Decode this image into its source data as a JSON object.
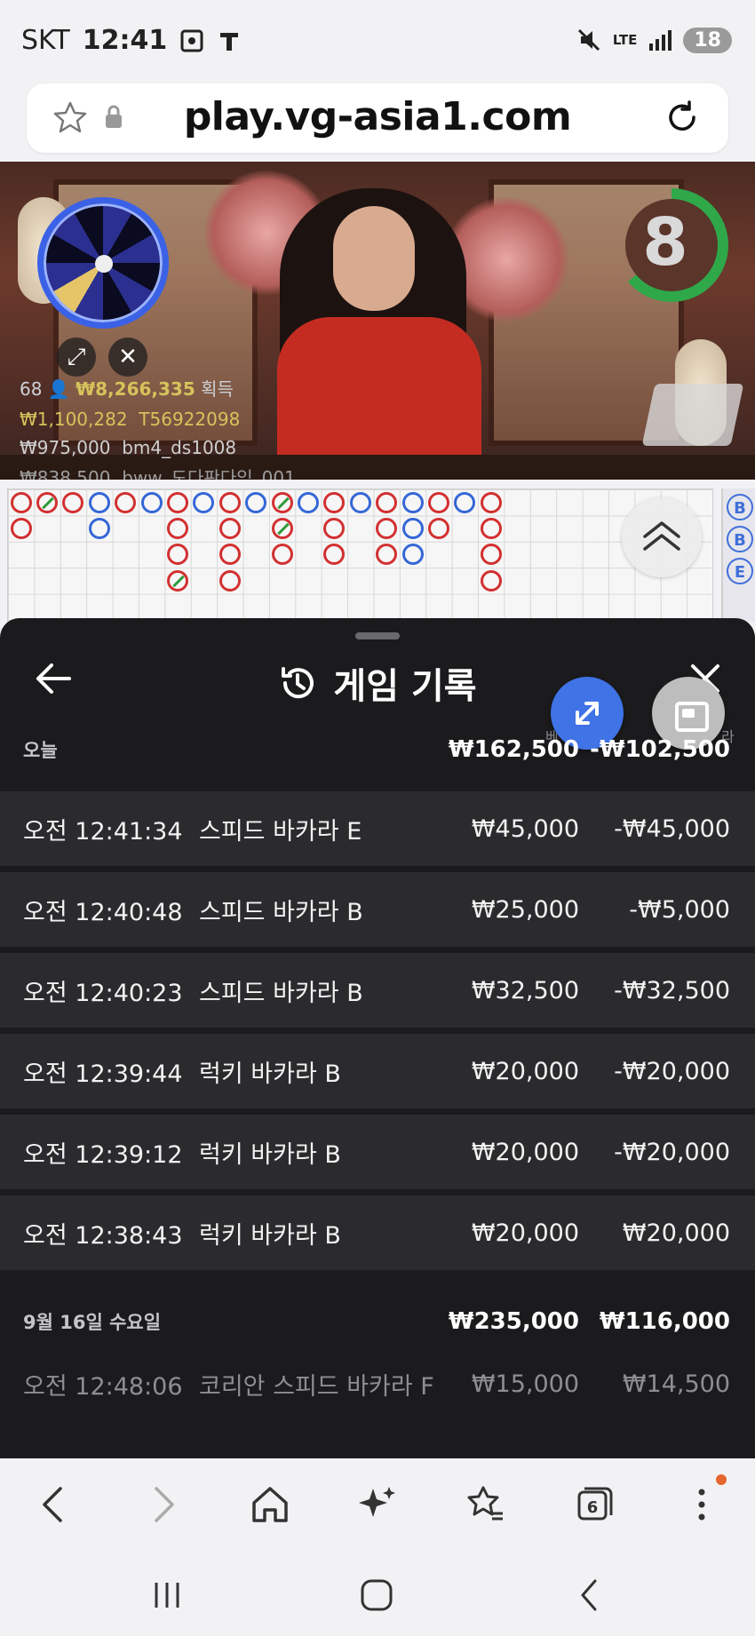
{
  "status": {
    "carrier": "SKT",
    "time": "12:41",
    "network": "LTE",
    "battery": "18"
  },
  "browser": {
    "url": "play.vg-asia1.com",
    "tab_count": "6"
  },
  "video": {
    "timer": "8",
    "players": "68",
    "win_amount": "₩8,266,335",
    "win_label": "획득",
    "bets": [
      {
        "amount": "₩1,100,282",
        "user": "T56922098"
      },
      {
        "amount": "₩975,000",
        "user": "bm4_ds1008"
      },
      {
        "amount": "₩838,500",
        "user": "bww_도다판다임_001"
      }
    ]
  },
  "road": {
    "side_labels": [
      "B",
      "B",
      "E"
    ],
    "columns": [
      [
        "p",
        "p"
      ],
      [
        "ps"
      ],
      [
        "p"
      ],
      [
        "b",
        "b"
      ],
      [
        "p"
      ],
      [
        "b"
      ],
      [
        "p",
        "p",
        "p",
        "ps"
      ],
      [
        "b"
      ],
      [
        "p",
        "p",
        "p",
        "p"
      ],
      [
        "b"
      ],
      [
        "ps",
        "ps",
        "p"
      ],
      [
        "b"
      ],
      [
        "p",
        "p",
        "p"
      ],
      [
        "b"
      ],
      [
        "p",
        "p",
        "p"
      ],
      [
        "b",
        "b",
        "b"
      ],
      [
        "p",
        "p"
      ],
      [
        "b"
      ],
      [
        "p",
        "p",
        "p",
        "p"
      ]
    ]
  },
  "history": {
    "title": "게임 기록",
    "column_hint_bet": "베",
    "column_hint_pl": "라",
    "days": [
      {
        "label": "오늘",
        "bet_total": "₩162,500",
        "pl_total": "-₩102,500",
        "rows": [
          {
            "time": "오전 12:41:34",
            "game": "스피드 바카라 E",
            "bet": "₩45,000",
            "pl": "-₩45,000"
          },
          {
            "time": "오전 12:40:48",
            "game": "스피드 바카라 B",
            "bet": "₩25,000",
            "pl": "-₩5,000"
          },
          {
            "time": "오전 12:40:23",
            "game": "스피드 바카라 B",
            "bet": "₩32,500",
            "pl": "-₩32,500"
          },
          {
            "time": "오전 12:39:44",
            "game": "럭키 바카라 B",
            "bet": "₩20,000",
            "pl": "-₩20,000"
          },
          {
            "time": "오전 12:39:12",
            "game": "럭키 바카라 B",
            "bet": "₩20,000",
            "pl": "-₩20,000"
          },
          {
            "time": "오전 12:38:43",
            "game": "럭키 바카라 B",
            "bet": "₩20,000",
            "pl": "₩20,000"
          }
        ]
      },
      {
        "label": "9월 16일 수요일",
        "bet_total": "₩235,000",
        "pl_total": "₩116,000",
        "rows": [
          {
            "time": "오전 12:48:06",
            "game": "코리안 스피드 바카라 F",
            "bet": "₩15,000",
            "pl": "₩14,500"
          }
        ]
      }
    ]
  },
  "colors": {
    "accent": "#3f73e6",
    "timer_green": "#2fa84a",
    "banker_red": "#d23030",
    "player_blue": "#3567d6",
    "sheet_bg": "#1b1b1d",
    "row_bg": "#2b2b2e"
  },
  "icons": [
    "star-icon",
    "lock-icon",
    "reload-icon",
    "back-arrow-icon",
    "history-icon",
    "close-icon",
    "expand-icon",
    "picture-in-picture-icon",
    "chevron-up-icon",
    "home-icon",
    "sparkle-icon",
    "bookmarks-icon",
    "tabs-icon",
    "more-icon"
  ]
}
